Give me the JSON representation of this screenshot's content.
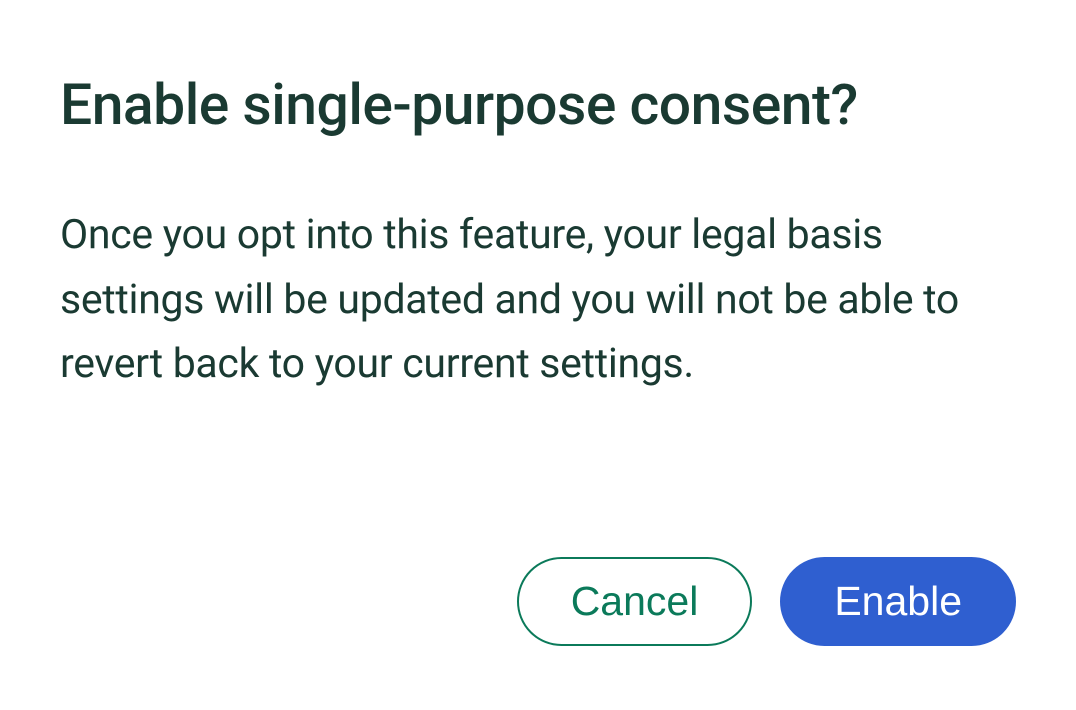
{
  "dialog": {
    "title": "Enable single-purpose consent?",
    "body": "Once you opt into this feature, your legal basis settings will be updated and you will not be able to revert back to your current settings.",
    "actions": {
      "cancel": "Cancel",
      "enable": "Enable"
    }
  }
}
